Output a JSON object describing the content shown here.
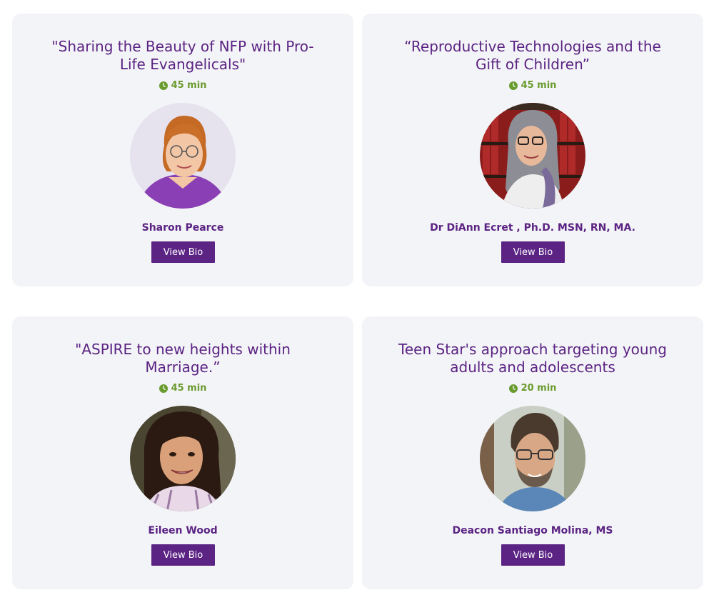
{
  "sessions": [
    {
      "title": "\"Sharing the Beauty of NFP with Pro-Life Evangelicals\"",
      "duration": "45 min",
      "speaker": "Sharon Pearce",
      "button_label": "View Bio"
    },
    {
      "title": "“Reproductive Technologies and the Gift of Children”",
      "duration": "45 min",
      "speaker": "Dr DiAnn Ecret , Ph.D. MSN, RN, MA.",
      "button_label": "View Bio"
    },
    {
      "title": "\"ASPIRE to new heights within Marriage.”",
      "duration": "45 min",
      "speaker": "Eileen Wood",
      "button_label": "View Bio"
    },
    {
      "title": "Teen Star's approach targeting young adults and adolescents",
      "duration": "20 min",
      "speaker": "Deacon Santiago Molina, MS",
      "button_label": "View Bio"
    }
  ],
  "colors": {
    "accent": "#5b2383",
    "duration": "#6a9b2f",
    "card_bg": "#f3f4f7"
  },
  "icons": {
    "duration": "clock-icon"
  }
}
